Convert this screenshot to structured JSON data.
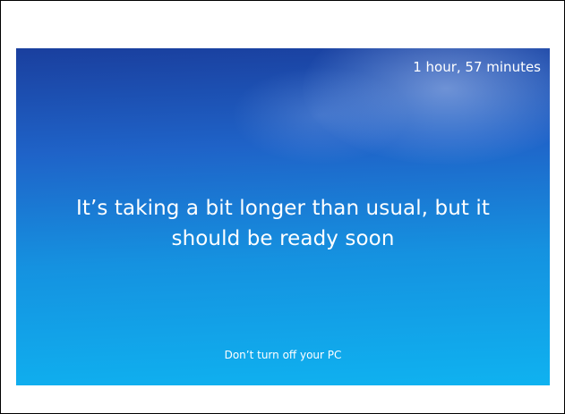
{
  "update_screen": {
    "time_remaining": "1 hour, 57 minutes",
    "message_line1": "It’s taking a bit longer than usual, but it",
    "message_line2": "should be ready soon",
    "footer_warning": "Don’t turn off your PC"
  },
  "colors": {
    "background_top": "#1a3f9e",
    "background_bottom": "#0fb2f0",
    "text": "#ffffff"
  }
}
